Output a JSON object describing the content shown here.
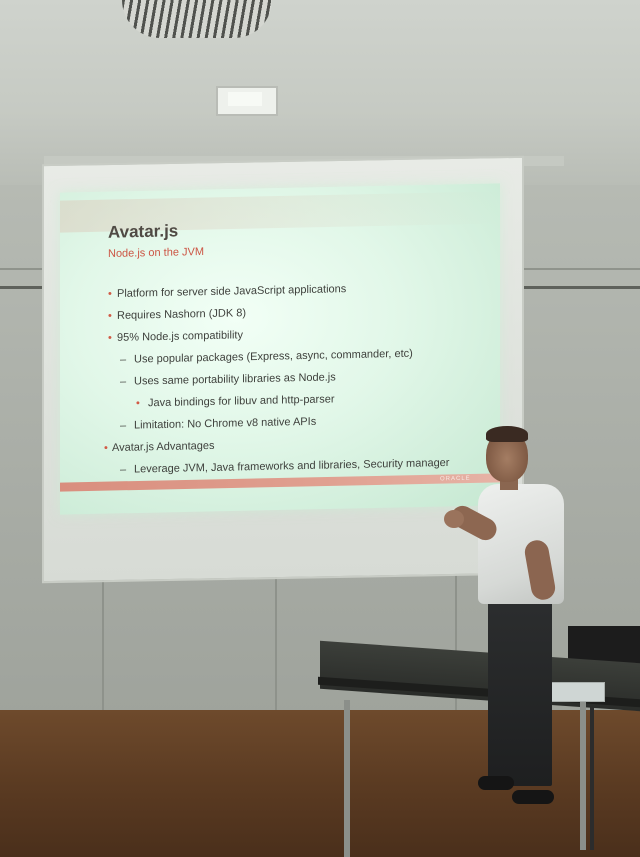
{
  "slide": {
    "title": "Avatar.js",
    "subtitle": "Node.js on the JVM",
    "bullets": [
      {
        "level": 1,
        "marker": "•",
        "text": "Platform for server side JavaScript applications"
      },
      {
        "level": 1,
        "marker": "•",
        "text": "Requires Nashorn (JDK 8)"
      },
      {
        "level": 1,
        "marker": "•",
        "text": "95% Node.js compatibility"
      },
      {
        "level": 2,
        "marker": "–",
        "text": "Use popular packages (Express, async, commander, etc)"
      },
      {
        "level": 2,
        "marker": "–",
        "text": "Uses same portability libraries as Node.js"
      },
      {
        "level": 3,
        "marker": "•",
        "text": "Java bindings for libuv and http-parser"
      },
      {
        "level": 2,
        "marker": "–",
        "text": "Limitation: No Chrome v8 native APIs"
      },
      {
        "level": "A",
        "marker": "•",
        "text": "Avatar.js Advantages"
      },
      {
        "level": 2,
        "marker": "–",
        "text": "Leverage JVM, Java frameworks and libraries, Security manager"
      }
    ],
    "footer_logo": "ORACLE",
    "colors": {
      "accent": "#cc5544",
      "footer_bar": "#d98e7e"
    }
  }
}
